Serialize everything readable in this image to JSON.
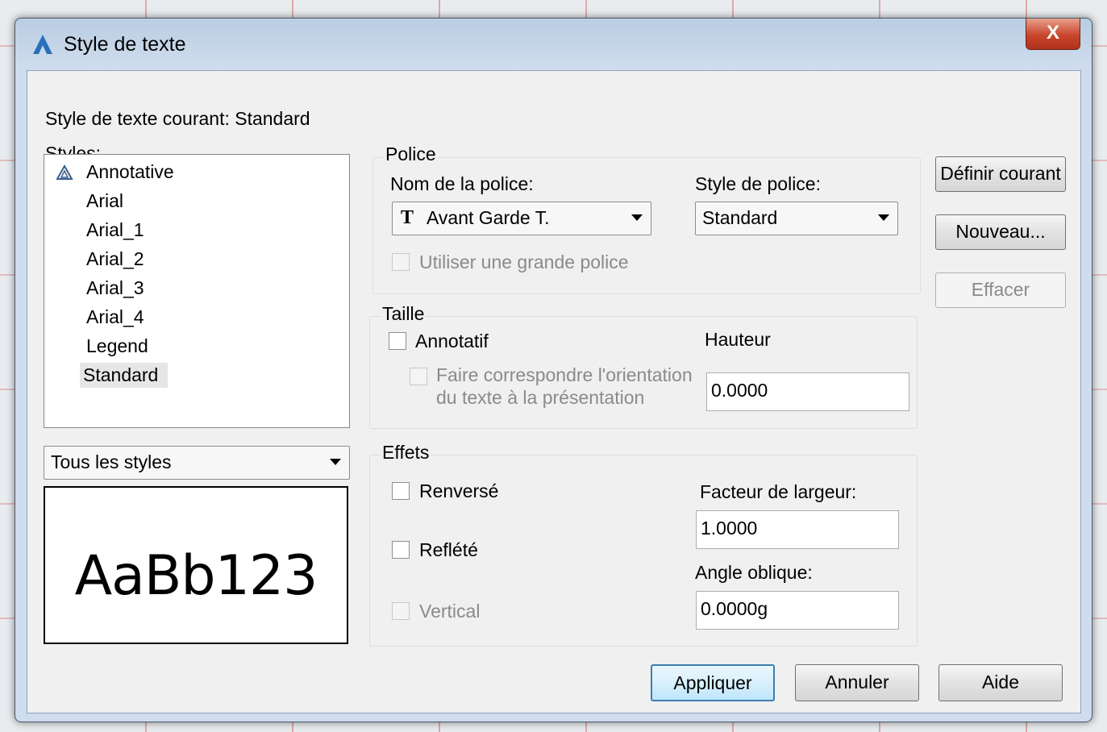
{
  "window": {
    "title": "Style de texte",
    "close_label": "X"
  },
  "current_style": "Style de texte courant: Standard",
  "styles_label": "Styles:",
  "styles": [
    {
      "label": "Annotative",
      "annotative": true
    },
    {
      "label": "Arial"
    },
    {
      "label": "Arial_1"
    },
    {
      "label": "Arial_2"
    },
    {
      "label": "Arial_3"
    },
    {
      "label": "Arial_4"
    },
    {
      "label": "Legend"
    },
    {
      "label": "Standard",
      "selected": true
    }
  ],
  "filter": {
    "value": "Tous les styles"
  },
  "preview": {
    "text": "AaBb123"
  },
  "police": {
    "group_title": "Police",
    "font_name_label": "Nom de la police:",
    "font_name_value": "Avant Garde T.",
    "font_style_label": "Style de police:",
    "font_style_value": "Standard",
    "big_font_label": "Utiliser une grande police"
  },
  "taille": {
    "group_title": "Taille",
    "annotative_label": "Annotatif",
    "match_orientation_line1": "Faire correspondre l'orientation",
    "match_orientation_line2": "du texte à la présentation",
    "height_label": "Hauteur",
    "height_value": "0.0000"
  },
  "effets": {
    "group_title": "Effets",
    "upside_down_label": "Renversé",
    "backwards_label": "Reflété",
    "vertical_label": "Vertical",
    "width_factor_label": "Facteur de largeur:",
    "width_factor_value": "1.0000",
    "oblique_angle_label": "Angle oblique:",
    "oblique_angle_value": "0.0000g"
  },
  "buttons": {
    "set_current": "Définir courant",
    "new": "Nouveau...",
    "delete": "Effacer",
    "apply": "Appliquer",
    "cancel": "Annuler",
    "help": "Aide"
  }
}
